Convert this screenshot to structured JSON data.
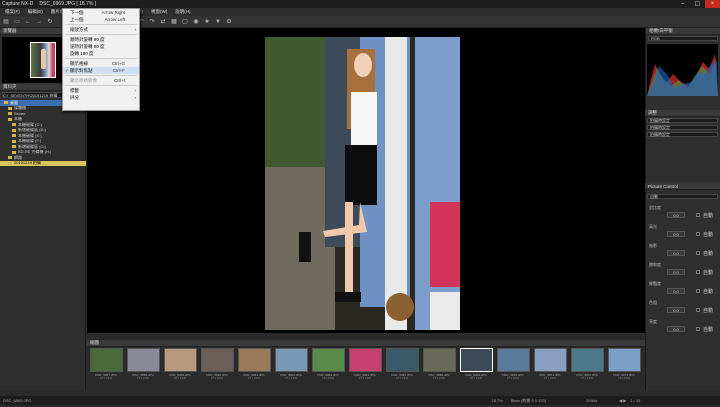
{
  "app": {
    "title": "Capture NX-D",
    "file": "DSC_6969.JPG [ 18.7% ]"
  },
  "menu": [
    "檔案(F)",
    "編輯(E)",
    "圖片/影片(I)",
    "檢視(V)",
    "調整(A)",
    "工具(T)",
    "視窗(W)",
    "說明(H)"
  ],
  "dropdown": {
    "items": [
      {
        "label": "下一個",
        "shortcut": "Arrow Right",
        "checked": false,
        "disabled": false,
        "sub": false
      },
      {
        "label": "上一個",
        "shortcut": "Arrow Left",
        "checked": false,
        "disabled": false,
        "sub": false
      },
      {
        "sep": true
      },
      {
        "label": "縮放方式",
        "shortcut": "",
        "checked": false,
        "disabled": false,
        "sub": true
      },
      {
        "sep": true
      },
      {
        "label": "順時針旋轉 90 度",
        "shortcut": "",
        "checked": false,
        "disabled": false,
        "sub": false
      },
      {
        "label": "逆時針旋轉 90 度",
        "shortcut": "",
        "checked": false,
        "disabled": false,
        "sub": false
      },
      {
        "label": "旋轉 180 度",
        "shortcut": "",
        "checked": false,
        "disabled": false,
        "sub": false
      },
      {
        "sep": true
      },
      {
        "label": "顯示格線",
        "shortcut": "Ctrl+G",
        "checked": false,
        "disabled": false,
        "sub": false
      },
      {
        "label": "顯示對焦點",
        "shortcut": "Ctrl+F",
        "checked": true,
        "disabled": false,
        "sub": false
      },
      {
        "sep": true
      },
      {
        "label": "顯示原始影像",
        "shortcut": "Ctrl+I",
        "checked": false,
        "disabled": true,
        "sub": false
      },
      {
        "sep": true
      },
      {
        "label": "標籤",
        "shortcut": "",
        "checked": false,
        "disabled": false,
        "sub": true
      },
      {
        "label": "評分",
        "shortcut": "",
        "checked": false,
        "disabled": false,
        "sub": true
      }
    ]
  },
  "left": {
    "browser_title": "瀏覽器",
    "folders_title": "資料夾",
    "path": "C:\\_SEVENTH\\20191219 拍攝",
    "tree": [
      {
        "label": "桌面",
        "indent": 1,
        "state": "sel"
      },
      {
        "label": "媒體櫃",
        "indent": 2,
        "state": ""
      },
      {
        "label": "Seven",
        "indent": 2,
        "state": ""
      },
      {
        "label": "本機",
        "indent": 2,
        "state": ""
      },
      {
        "label": "本機磁碟 (C:)",
        "indent": 3,
        "state": ""
      },
      {
        "label": "新增磁碟區 (D:)",
        "indent": 3,
        "state": ""
      },
      {
        "label": "本機磁碟 (E:)",
        "indent": 3,
        "state": ""
      },
      {
        "label": "本機磁碟 (F:)",
        "indent": 3,
        "state": ""
      },
      {
        "label": "新增磁碟區 (G:)",
        "indent": 3,
        "state": ""
      },
      {
        "label": "BD-RE 光碟機 (H:)",
        "indent": 3,
        "state": ""
      },
      {
        "label": "網路",
        "indent": 2,
        "state": ""
      },
      {
        "label": "20191219 拍攝",
        "indent": 2,
        "state": "hi"
      }
    ]
  },
  "right": {
    "histogram_title": "相機/白平衡",
    "channel": "RGB",
    "adjust_title": "調整",
    "picture_control": "Picture Control",
    "preset": "自動",
    "slider_labels": [
      "對比度",
      "高光",
      "陰影",
      "飽和度",
      "鮮豔度",
      "色相",
      "亮度"
    ],
    "slider_value": "0.0",
    "auto_label": "自動",
    "rows": [
      "拍攝時設定",
      "拍攝時設定",
      "拍攝時設定"
    ]
  },
  "filmstrip": {
    "title": "縮圖",
    "thumbs": [
      {
        "name": "DSC_6957.JPG",
        "info": "F3.2 1/200"
      },
      {
        "name": "DSC_6958.JPG",
        "info": "F3.2 1/200"
      },
      {
        "name": "DSC_6959.JPG",
        "info": "F3.2 1/200"
      },
      {
        "name": "DSC_6960.JPG",
        "info": "F3.2 1/200"
      },
      {
        "name": "DSC_6961.JPG",
        "info": "F3.2 1/200"
      },
      {
        "name": "DSC_6962.JPG",
        "info": "F3.2 1/200"
      },
      {
        "name": "DSC_6963.JPG",
        "info": "F3.2 1/200"
      },
      {
        "name": "DSC_6964.JPG",
        "info": "F3.2 1/200"
      },
      {
        "name": "DSC_6965.JPG",
        "info": "F3.2 1/200"
      },
      {
        "name": "DSC_6966.JPG",
        "info": "F3.2 1/200"
      },
      {
        "name": "DSC_6969.JPG",
        "info": "F3.2 1/200"
      },
      {
        "name": "DSC_6970.JPG",
        "info": "F3.2 1/200"
      },
      {
        "name": "DSC_6971.JPG",
        "info": "F3.2 1/200"
      },
      {
        "name": "DSC_6972.JPG",
        "info": "F3.2 1/200"
      },
      {
        "name": "DSC_6973.JPG",
        "info": "F3.2 1/200"
      }
    ]
  },
  "status": {
    "left": "DSC_6969.JPG",
    "zoom": "18.7%",
    "info": "Bbox (約需 0 0 333)",
    "count": "1 / 15",
    "right": "2Mb/s",
    "nav": "◀ ▶"
  }
}
